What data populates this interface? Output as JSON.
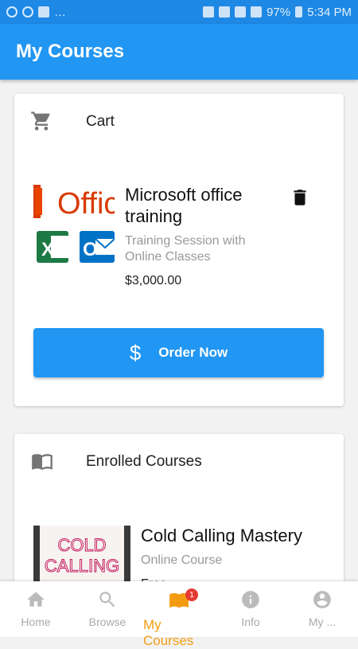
{
  "status_bar": {
    "battery": "97%",
    "time": "5:34 PM"
  },
  "appbar": {
    "title": "My Courses"
  },
  "cart": {
    "title": "Cart",
    "icon": "cart-icon",
    "item": {
      "title": "Microsoft office training",
      "subtitle": "Training Session with Online Classes",
      "price": "$3,000.00",
      "thumb_text": "Offic"
    },
    "order_button": "Order Now"
  },
  "enrolled": {
    "title": "Enrolled Courses",
    "icon": "book-icon",
    "item": {
      "title": "Cold Calling Mastery",
      "subtitle": "Online Course",
      "price": "Free",
      "thumb_line1": "COLD",
      "thumb_line2": "CALLING"
    }
  },
  "bottom_nav": {
    "items": [
      {
        "label": "Home",
        "icon": "home-icon"
      },
      {
        "label": "Browse",
        "icon": "search-icon"
      },
      {
        "label": "My Courses",
        "icon": "courses-icon",
        "badge": "1"
      },
      {
        "label": "Info",
        "icon": "info-icon"
      },
      {
        "label": "My ...",
        "icon": "account-icon"
      }
    ]
  },
  "colors": {
    "primary": "#2196f3",
    "active": "#f39c12",
    "badge": "#e53935"
  }
}
